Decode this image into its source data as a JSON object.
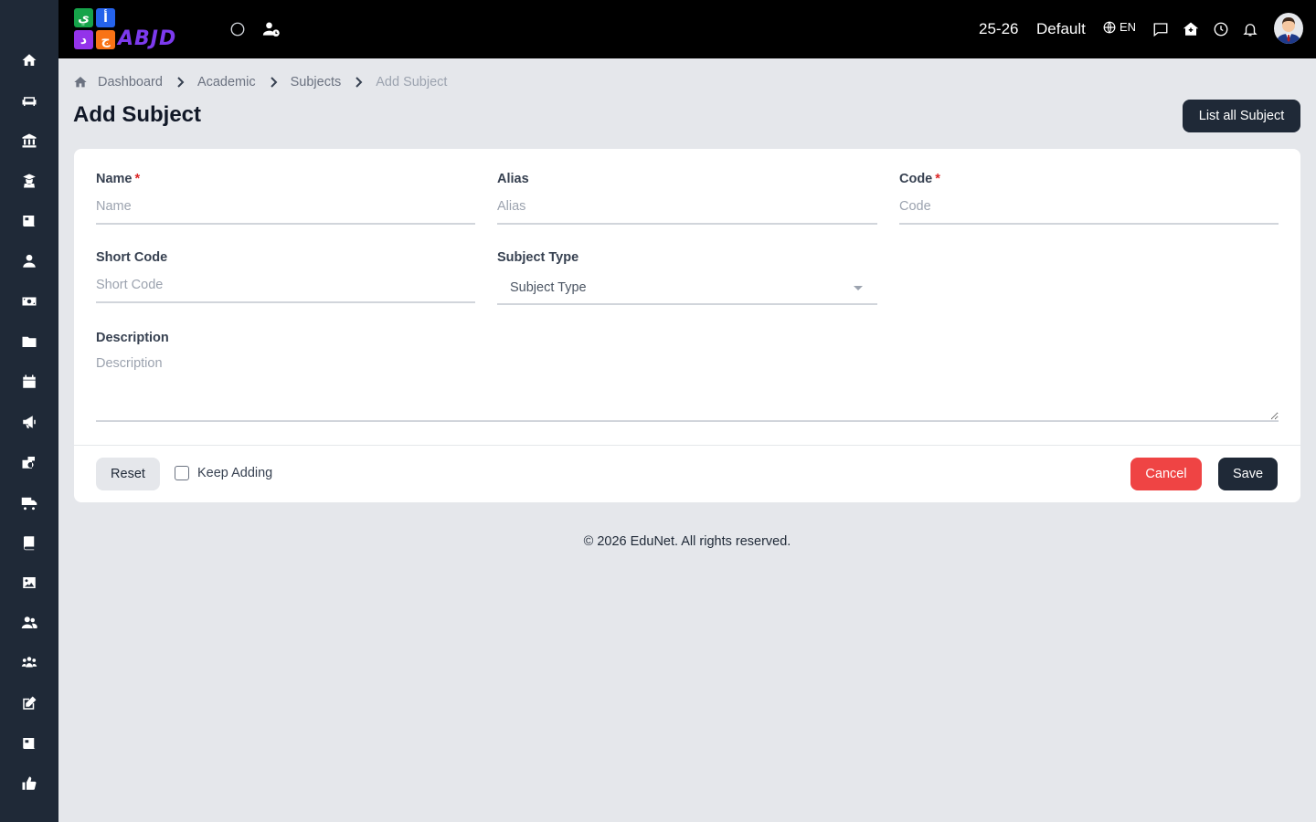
{
  "header": {
    "logo_letters": [
      "ي",
      "أ",
      "د",
      "ج"
    ],
    "logo_word": "ABJD",
    "session": "25-26",
    "profile": "Default",
    "language": "EN"
  },
  "sidebar": {
    "items": [
      {
        "icon": "home-icon"
      },
      {
        "icon": "sofa-icon"
      },
      {
        "icon": "institution-icon"
      },
      {
        "icon": "graduate-icon"
      },
      {
        "icon": "newspaper-icon"
      },
      {
        "icon": "user-icon"
      },
      {
        "icon": "money-icon"
      },
      {
        "icon": "folder-icon"
      },
      {
        "icon": "calendar-icon"
      },
      {
        "icon": "megaphone-icon"
      },
      {
        "icon": "school-icon"
      },
      {
        "icon": "truck-icon"
      },
      {
        "icon": "book-icon"
      },
      {
        "icon": "image-icon"
      },
      {
        "icon": "users-icon"
      },
      {
        "icon": "people-group-icon"
      },
      {
        "icon": "edit-icon"
      },
      {
        "icon": "news-icon"
      },
      {
        "icon": "thumbs-up-icon"
      }
    ]
  },
  "breadcrumb": {
    "items": [
      "Dashboard",
      "Academic",
      "Subjects",
      "Add Subject"
    ]
  },
  "page": {
    "title": "Add Subject",
    "list_all_label": "List all Subject"
  },
  "form": {
    "name": {
      "label": "Name",
      "placeholder": "Name",
      "required": "*"
    },
    "alias": {
      "label": "Alias",
      "placeholder": "Alias"
    },
    "code": {
      "label": "Code",
      "placeholder": "Code",
      "required": "*"
    },
    "short_code": {
      "label": "Short Code",
      "placeholder": "Short Code"
    },
    "subject_type": {
      "label": "Subject Type",
      "selected": "Subject Type"
    },
    "description": {
      "label": "Description",
      "placeholder": "Description"
    }
  },
  "actions": {
    "reset": "Reset",
    "keep_adding": "Keep Adding",
    "cancel": "Cancel",
    "save": "Save"
  },
  "footer": {
    "copyright": "© 2026 EduNet. All rights reserved."
  },
  "colors": {
    "sidebar": "#1f2937",
    "header": "#000000",
    "primary": "#1f2937",
    "danger": "#ef4444",
    "background": "#e5e7eb"
  }
}
